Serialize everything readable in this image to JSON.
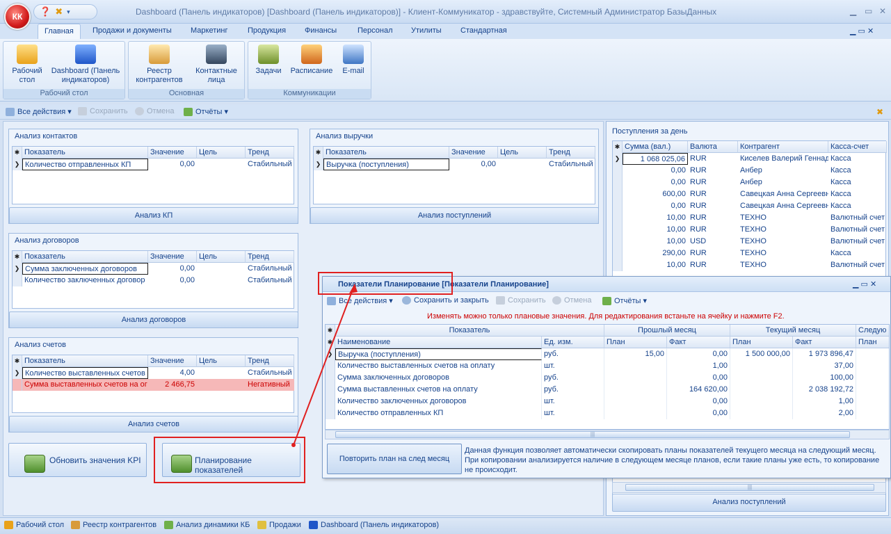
{
  "app": {
    "orb_label": "КК",
    "title": "Dashboard (Панель индикаторов) [Dashboard (Панель индикаторов)] - Клиент-Коммуникатор - здравствуйте, Системный Администратор БазыДанных",
    "min": "▁",
    "max": "▭",
    "close": "✕",
    "help_icon": "help-icon",
    "qat_icon": "qat-icon"
  },
  "tabs": [
    "Главная",
    "Продажи и документы",
    "Маркетинг",
    "Продукция",
    "Финансы",
    "Персонал",
    "Утилиты",
    "Стандартная"
  ],
  "ribbon": {
    "groups": [
      {
        "label": "Рабочий стол",
        "buttons": [
          "Рабочий\nстол",
          "Dashboard (Панель\nиндикаторов)"
        ]
      },
      {
        "label": "Основная",
        "buttons": [
          "Реестр\nконтрагентов",
          "Контактные\nлица"
        ]
      },
      {
        "label": "Коммуникации",
        "buttons": [
          "Задачи",
          "Расписание",
          "E-mail"
        ]
      }
    ]
  },
  "toolbar": {
    "all_actions": "Все действия",
    "save": "Сохранить",
    "cancel": "Отмена",
    "reports": "Отчёты"
  },
  "panels": {
    "contacts": {
      "title": "Анализ контактов",
      "headers": [
        "Показатель",
        "Значение",
        "Цель",
        "Тренд"
      ],
      "rows": [
        [
          "Количество отправленных КП",
          "0,00",
          "",
          "Стабильный"
        ]
      ],
      "button": "Анализ КП"
    },
    "revenue": {
      "title": "Анализ выручки",
      "headers": [
        "Показатель",
        "Значение",
        "Цель",
        "Тренд"
      ],
      "rows": [
        [
          "Выручка (поступления)",
          "0,00",
          "",
          "Стабильный"
        ]
      ],
      "button": "Анализ поступлений"
    },
    "contracts": {
      "title": "Анализ договоров",
      "headers": [
        "Показатель",
        "Значение",
        "Цель",
        "Тренд"
      ],
      "rows": [
        [
          "Сумма заключенных договоров",
          "0,00",
          "",
          "Стабильный"
        ],
        [
          "Количество заключенных договор",
          "0,00",
          "",
          "Стабильный"
        ]
      ],
      "button": "Анализ договоров"
    },
    "invoices": {
      "title": "Анализ счетов",
      "headers": [
        "Показатель",
        "Значение",
        "Цель",
        "Тренд"
      ],
      "rows": [
        [
          "Количество выставленных счетов",
          "4,00",
          "",
          "Стабильный"
        ],
        [
          "Сумма выставленных счетов на ог",
          "2 466,75",
          "",
          "Негативный"
        ]
      ],
      "button": "Анализ счетов"
    },
    "daily": {
      "title": "Поступления за день",
      "headers": [
        "Сумма (вал.)",
        "Валюта",
        "Контрагент",
        "Касса-счет"
      ],
      "rows": [
        [
          "1 068 025,06",
          "RUR",
          "Киселев Валерий Геннад",
          "Касса"
        ],
        [
          "0,00",
          "RUR",
          "Анбер",
          "Касса"
        ],
        [
          "0,00",
          "RUR",
          "Анбер",
          "Касса"
        ],
        [
          "600,00",
          "RUR",
          "Савецкая Анна Сергеевн",
          "Касса"
        ],
        [
          "0,00",
          "RUR",
          "Савецкая Анна Сергеевн",
          "Касса"
        ],
        [
          "10,00",
          "RUR",
          "ТЕХНО",
          "Валютный счет"
        ],
        [
          "10,00",
          "RUR",
          "ТЕХНО",
          "Валютный счет"
        ],
        [
          "10,00",
          "USD",
          "ТЕХНО",
          "Валютный счет"
        ],
        [
          "290,00",
          "RUR",
          "ТЕХНО",
          "Касса"
        ],
        [
          "10,00",
          "RUR",
          "ТЕХНО",
          "Валютный счет"
        ]
      ],
      "button": "Анализ поступлений"
    }
  },
  "kpi_buttons": {
    "update": "Обновить значения KPI",
    "planning": "Планирование показателей"
  },
  "popup": {
    "title": "Показатели Планирование [Показатели Планирование]",
    "toolbar": {
      "all_actions": "Все действия",
      "save_close": "Сохранить и закрыть",
      "save": "Сохранить",
      "cancel": "Отмена",
      "reports": "Отчёты"
    },
    "notice": "Изменять можно только плановые значения. Для редактирования встаньте на ячейку и нажмите F2.",
    "group_headers": [
      "Показатель",
      "Прошлый месяц",
      "Текущий месяц",
      "Следую"
    ],
    "sub_headers": [
      "Наименование",
      "Ед. изм.",
      "План",
      "Факт",
      "План",
      "Факт",
      "План"
    ],
    "rows": [
      [
        "Выручка (поступления)",
        "руб.",
        "15,00",
        "0,00",
        "1 500 000,00",
        "1 973 896,47"
      ],
      [
        "Количество выставленных счетов на оплату",
        "шт.",
        "",
        "1,00",
        "",
        "37,00"
      ],
      [
        "Сумма заключенных договоров",
        "руб.",
        "",
        "0,00",
        "",
        "100,00"
      ],
      [
        "Сумма выставленных счетов на оплату",
        "руб.",
        "",
        "164 620,00",
        "",
        "2 038 192,72"
      ],
      [
        "Количество заключенных договоров",
        "шт.",
        "",
        "0,00",
        "",
        "1,00"
      ],
      [
        "Количество отправленных КП",
        "шт.",
        "",
        "0,00",
        "",
        "2,00"
      ]
    ],
    "repeat_button": "Повторить план на след месяц",
    "description": "Данная функция позволяет автоматически скопировать планы показателей текущего месяца на следующий месяц. При копировании анализируется наличие в следующем месяце планов, если такие планы уже есть, то копирование не происходит."
  },
  "statusbar": [
    "Рабочий стол",
    "Реестр контрагентов",
    "Анализ динамики КБ",
    "Продажи",
    "Dashboard (Панель индикаторов)"
  ],
  "colors": {
    "accent": "#15428b",
    "annotation": "#e02020",
    "negative_row": "#f6b8b8"
  }
}
